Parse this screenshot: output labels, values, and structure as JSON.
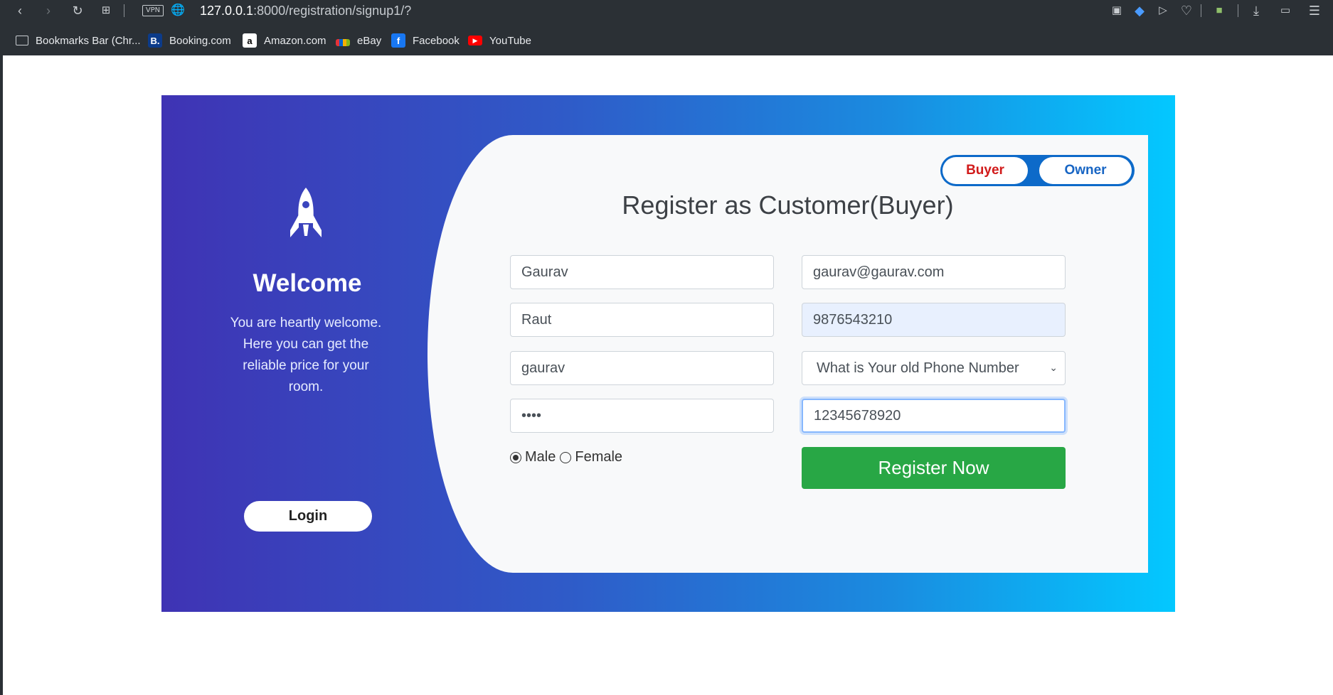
{
  "browser": {
    "url_host": "127.0.0.1",
    "url_path": ":8000/registration/signup1/?",
    "vpn_label": "VPN",
    "bookmarks": [
      {
        "label": "Bookmarks Bar (Chr...",
        "icon": "folder-icon"
      },
      {
        "label": "Booking.com",
        "icon": "booking-icon",
        "glyph": "B."
      },
      {
        "label": "Amazon.com",
        "icon": "amazon-icon",
        "glyph": "a"
      },
      {
        "label": "eBay",
        "icon": "ebay-icon"
      },
      {
        "label": "Facebook",
        "icon": "facebook-icon",
        "glyph": "f"
      },
      {
        "label": "YouTube",
        "icon": "youtube-icon",
        "glyph": "▶"
      }
    ]
  },
  "left": {
    "title": "Welcome",
    "text": "You are heartly welcome. Here you can get the reliable price for your room.",
    "login_label": "Login"
  },
  "toggle": {
    "buyer_label": "Buyer",
    "owner_label": "Owner"
  },
  "form": {
    "title": "Register as Customer(Buyer)",
    "first_name": "Gaurav",
    "last_name": "Raut",
    "username": "gaurav",
    "password": "••••",
    "email": "gaurav@gaurav.com",
    "phone": "9876543210",
    "security_question": "What is Your old Phone Number",
    "security_answer": "12345678920",
    "gender_male": "Male",
    "gender_female": "Female",
    "register_label": "Register Now"
  },
  "colors": {
    "accent_green": "#28a745",
    "toggle_blue": "#0d6ac9",
    "buyer_red": "#d11a1a"
  }
}
